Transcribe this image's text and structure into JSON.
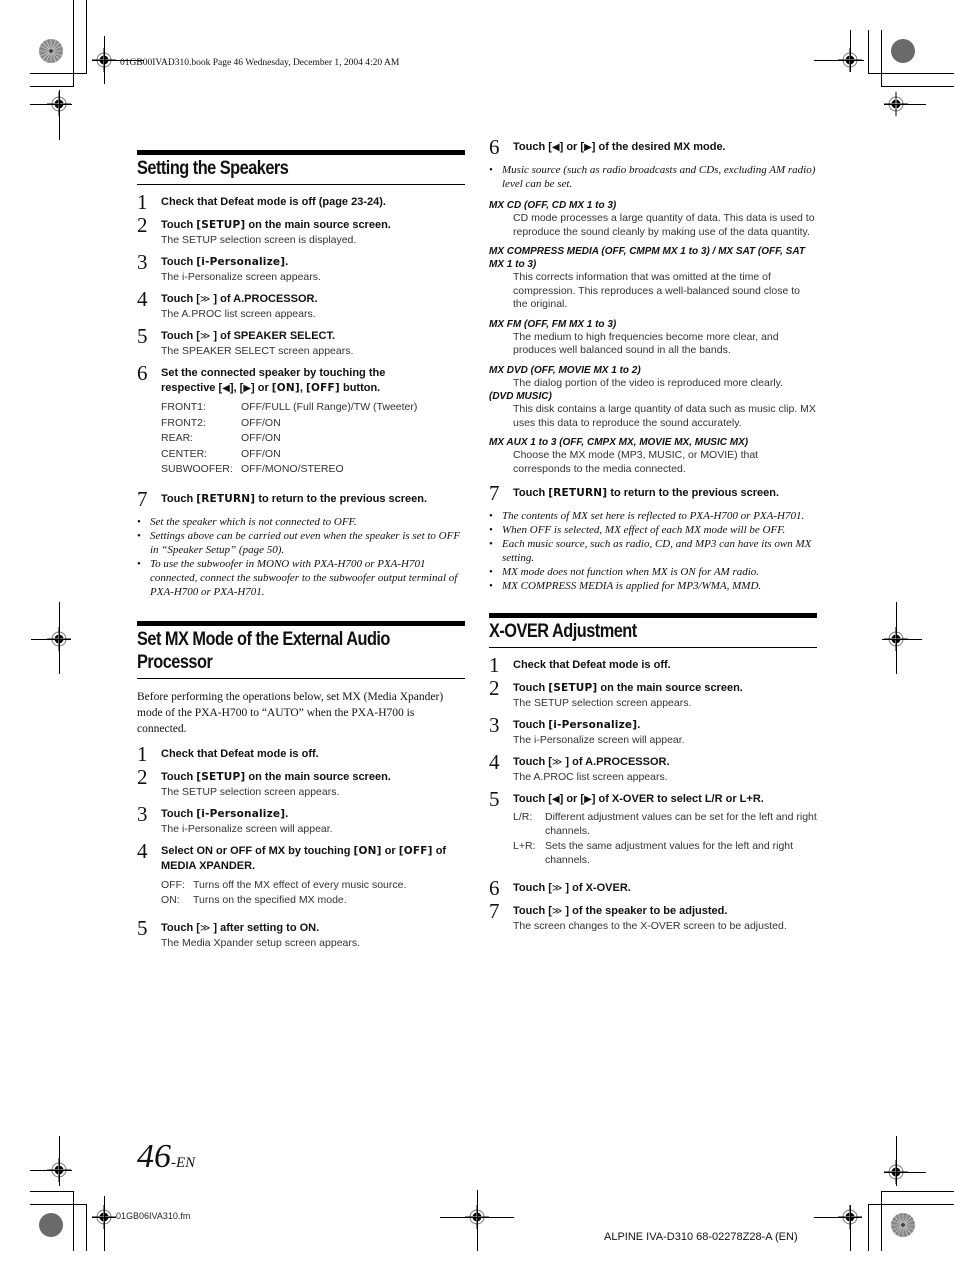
{
  "header": {
    "book_info": "01GB00IVAD310.book  Page 46  Wednesday, December 1, 2004  4:20 AM"
  },
  "left_column": {
    "section1": {
      "title": "Setting the Speakers",
      "steps": [
        {
          "num": "1",
          "head": "Check that Defeat mode is off (page 23-24)."
        },
        {
          "num": "2",
          "head_pre": "Touch ",
          "kw": "[SETUP]",
          "head_post": " on the main source screen.",
          "desc": "The SETUP selection screen is displayed."
        },
        {
          "num": "3",
          "head_pre": "Touch ",
          "kw": "[i-Personalize]",
          "head_post": ".",
          "desc": "The i-Personalize screen appears."
        },
        {
          "num": "4",
          "head_pre": "Touch [",
          "glyph": "≫",
          "head_post": " ] of A.PROCESSOR.",
          "desc": "The A.PROC list screen appears."
        },
        {
          "num": "5",
          "head_pre": "Touch [",
          "glyph": "≫",
          "head_post": " ] of SPEAKER SELECT.",
          "desc": "The SPEAKER SELECT screen appears."
        },
        {
          "num": "6",
          "head_line1": "Set the connected speaker by touching the",
          "head_line2_pre": "respective [",
          "glyph_left": "◀",
          "mid1": "], [",
          "glyph_right": "▶",
          "mid2": "] or ",
          "kw_on": "[ON]",
          "mid3": ", ",
          "kw_off": "[OFF]",
          "head_post": " button."
        },
        {
          "num": "7",
          "head_pre": "Touch ",
          "kw": "[RETURN]",
          "head_post": " to return to the previous screen."
        }
      ],
      "speaker_options": [
        {
          "label": "FRONT1:",
          "value": "OFF/FULL (Full Range)/TW (Tweeter)"
        },
        {
          "label": "FRONT2:",
          "value": "OFF/ON"
        },
        {
          "label": "REAR:",
          "value": "OFF/ON"
        },
        {
          "label": "CENTER:",
          "value": "OFF/ON"
        },
        {
          "label": "SUBWOOFER:",
          "value": "OFF/MONO/STEREO"
        }
      ],
      "notes": [
        "Set the speaker which is not connected to OFF.",
        "Settings above can be carried out even when the speaker is set to OFF in “Speaker Setup” (page 50).",
        "To use the subwoofer in MONO with PXA-H700 or PXA-H701 connected, connect the subwoofer to the subwoofer output terminal of PXA-H700 or PXA-H701."
      ]
    },
    "section2": {
      "title": "Set MX Mode of the External Audio Processor",
      "intro": "Before performing the operations below, set MX (Media Xpander) mode of the PXA-H700 to “AUTO” when the PXA-H700 is connected.",
      "steps": [
        {
          "num": "1",
          "head": "Check that Defeat mode is off."
        },
        {
          "num": "2",
          "head_pre": "Touch ",
          "kw": "[SETUP]",
          "head_post": " on the main source screen.",
          "desc": "The SETUP selection screen appears."
        },
        {
          "num": "3",
          "head_pre": "Touch ",
          "kw": "[i-Personalize]",
          "head_post": ".",
          "desc": "The i-Personalize screen will appear."
        },
        {
          "num": "4",
          "head_pre": "Select ON or OFF of MX by touching ",
          "kw_on": "[ON]",
          "mid": " or ",
          "kw_off": "[OFF]",
          "head_post": " of MEDIA XPANDER."
        },
        {
          "num": "5",
          "head_pre": "Touch [",
          "glyph": "≫",
          "head_post": " ] after setting to ON.",
          "desc": "The Media Xpander setup screen appears."
        }
      ],
      "mx_options": [
        {
          "label": "OFF:",
          "value": "Turns off the MX effect of every music source."
        },
        {
          "label": "ON:",
          "value": "Turns on the specified MX mode."
        }
      ]
    }
  },
  "right_column": {
    "step6": {
      "num": "6",
      "head_pre": "Touch [",
      "glyph_left": "◀",
      "mid": "] or [",
      "glyph_right": "▶",
      "head_post": "] of the desired MX mode."
    },
    "step6_note": "Music source (such as radio broadcasts and CDs, excluding AM radio) level can be set.",
    "mx_modes": [
      {
        "title": "MX CD (OFF, CD MX 1 to 3)",
        "desc": "CD mode processes a large quantity of data. This data is used to reproduce the sound cleanly by making use of the data quantity."
      },
      {
        "title": "MX COMPRESS MEDIA (OFF, CMPM MX 1 to 3) / MX SAT (OFF, SAT MX 1 to 3)",
        "desc": "This corrects information that was omitted at the time of compression. This reproduces a well-balanced sound close to the original."
      },
      {
        "title": "MX FM (OFF, FM MX 1 to 3)",
        "desc": "The medium to high frequencies become more clear, and produces well balanced sound in all the bands."
      },
      {
        "title": "MX DVD (OFF, MOVIE MX 1 to 2)",
        "desc": "The dialog portion of the video is reproduced more clearly."
      },
      {
        "title": "(DVD MUSIC)",
        "desc": "This disk contains a large quantity of data such as music clip. MX uses this data to reproduce the sound accurately."
      },
      {
        "title": "MX AUX 1 to 3 (OFF, CMPX MX, MOVIE MX, MUSIC MX)",
        "desc": "Choose the MX mode (MP3, MUSIC, or MOVIE) that corresponds to the media connected."
      }
    ],
    "step7": {
      "num": "7",
      "head_pre": "Touch ",
      "kw": "[RETURN]",
      "head_post": " to return to the previous screen."
    },
    "step7_notes": [
      "The contents of MX set here is reflected to PXA-H700 or PXA-H701.",
      "When OFF is selected, MX effect of each MX mode will be OFF.",
      "Each music source, such as radio, CD, and MP3 can have its own MX setting.",
      "MX mode does not function when MX is ON for AM radio.",
      "MX COMPRESS MEDIA is applied for MP3/WMA, MMD."
    ],
    "section3": {
      "title": "X-OVER Adjustment",
      "steps": [
        {
          "num": "1",
          "head": "Check that Defeat mode is off."
        },
        {
          "num": "2",
          "head_pre": "Touch ",
          "kw": "[SETUP]",
          "head_post": " on the main source screen.",
          "desc": "The SETUP selection screen appears."
        },
        {
          "num": "3",
          "head_pre": "Touch ",
          "kw": "[i-Personalize]",
          "head_post": ".",
          "desc": "The i-Personalize screen will appear."
        },
        {
          "num": "4",
          "head_pre": "Touch [",
          "glyph": "≫",
          "head_post": " ] of A.PROCESSOR.",
          "desc": "The A.PROC list screen appears."
        },
        {
          "num": "5",
          "head_pre": "Touch [",
          "glyph_left": "◀",
          "mid": "] or [",
          "glyph_right": "▶",
          "head_post": "] of X-OVER to select L/R or L+R."
        },
        {
          "num": "6",
          "head_pre": "Touch [",
          "glyph": "≫",
          "head_post": " ] of X-OVER."
        },
        {
          "num": "7",
          "head_pre": "Touch [",
          "glyph": "≫",
          "head_post": " ] of the speaker to be adjusted.",
          "desc": "The screen changes to the X-OVER screen to be adjusted."
        }
      ],
      "channel_options": [
        {
          "label": "L/R:",
          "value": "Different adjustment values can be set for the left and right channels."
        },
        {
          "label": "L+R:",
          "value": "Sets the same adjustment values for the left and right channels."
        }
      ]
    }
  },
  "footer": {
    "page_number": "46",
    "page_suffix": "-EN",
    "fm_file": "01GB06IVA310.fm",
    "model_code": "ALPINE IVA-D310 68-02278Z28-A (EN)"
  }
}
